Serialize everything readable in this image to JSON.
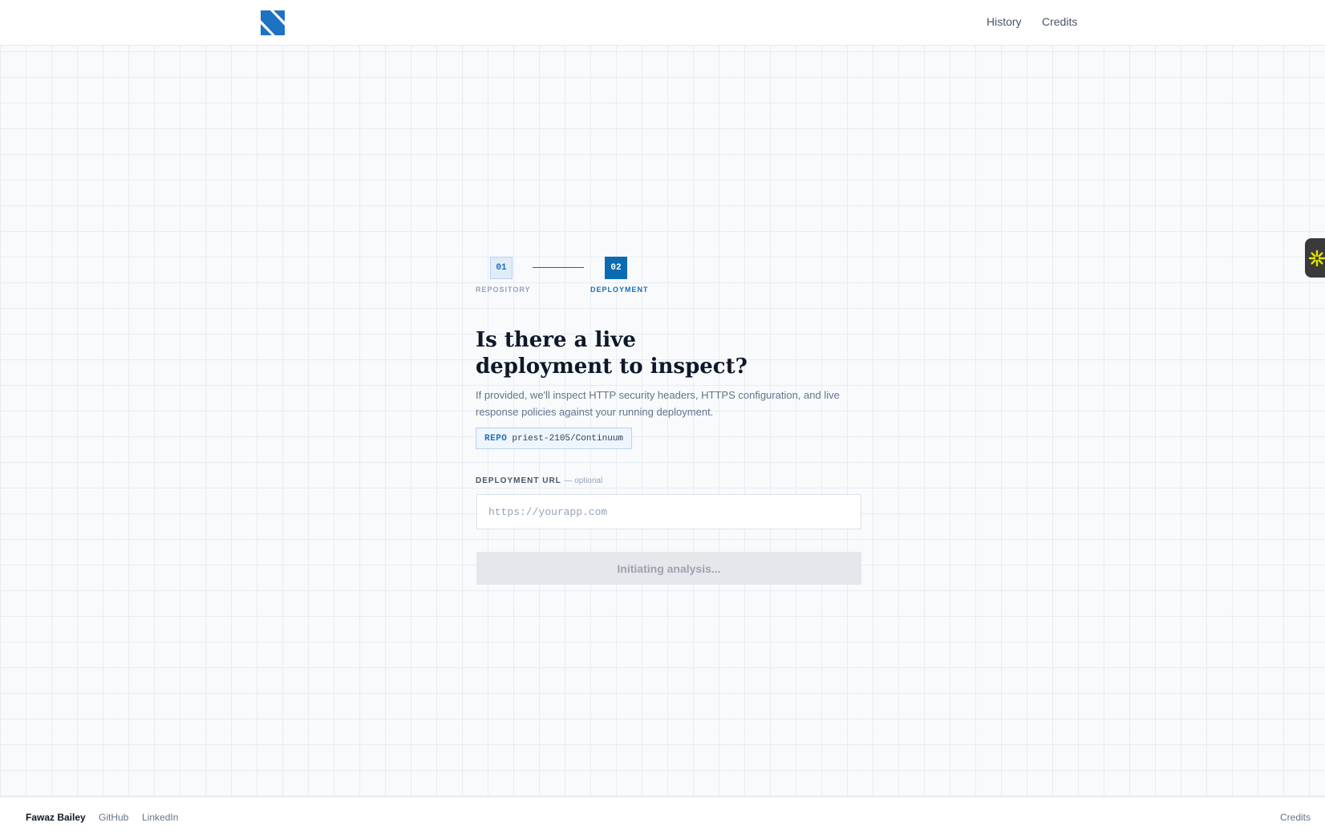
{
  "header": {
    "logo_icon": "s-logo-icon",
    "brand_color": "#1d72c2",
    "nav": {
      "history_label": "History",
      "credits_label": "Credits"
    }
  },
  "stepper": {
    "steps": [
      {
        "number": "01",
        "label": "REPOSITORY",
        "state": "completed"
      },
      {
        "number": "02",
        "label": "DEPLOYMENT",
        "state": "active"
      }
    ],
    "active_color": "#0b6bb0"
  },
  "main": {
    "headline_line1": "Is there a live",
    "headline_line2": "deployment to inspect?",
    "subtext": "If provided, we'll inspect HTTP security headers, HTTPS configuration, and live response policies against your running deployment.",
    "repo_tag": "REPO",
    "repo_name": "priest-2105/Continuum",
    "field_label": "DEPLOYMENT URL",
    "field_optional": "— optional",
    "url_value": "",
    "url_placeholder": "https://yourapp.com",
    "submit_label": "Initiating analysis..."
  },
  "side_widget": {
    "icon": "asterisk-spark-icon",
    "icon_color": "#e6e600"
  },
  "footer": {
    "author": "Fawaz Bailey",
    "github_label": "GitHub",
    "linkedin_label": "LinkedIn",
    "credits_label": "Credits"
  }
}
